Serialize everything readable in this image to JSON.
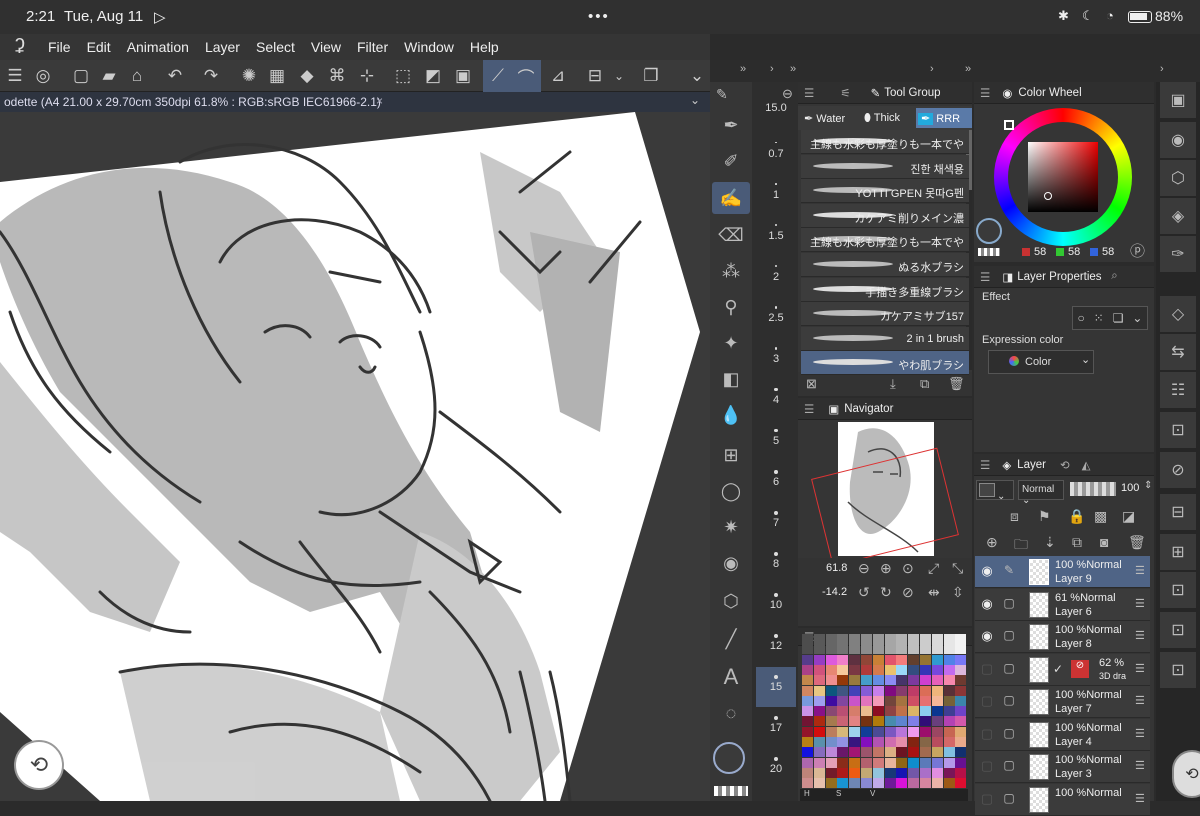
{
  "status": {
    "time": "2:21",
    "date": "Tue, Aug 11",
    "dots": "•••",
    "battery": "88%"
  },
  "menu": [
    "File",
    "Edit",
    "Animation",
    "Layer",
    "Select",
    "View",
    "Filter",
    "Window",
    "Help"
  ],
  "document": {
    "title": "odette (A4 21.00 x 29.70cm 350dpi 61.8% : RGB:sRGB IEC61966-2.1)",
    "close": "×"
  },
  "brush_sizes": [
    "15.0",
    "0.7",
    "1",
    "1.5",
    "2",
    "2.5",
    "3",
    "4",
    "5",
    "6",
    "7",
    "8",
    "10",
    "12",
    "15",
    "17",
    "20"
  ],
  "brush_size_selected": "15",
  "tool_group": {
    "title": "Tool Group",
    "tabs": [
      "Water",
      "Thick",
      "RRR"
    ],
    "active_tab": "RRR"
  },
  "brushes": [
    "主線も水彩も厚塗りも一本でや",
    "진한 채색용",
    "YOTTI GPEN 못따G펜",
    "カケアミ削りメイン濃",
    "主線も水彩も厚塗りも一本でや",
    "ぬる水ブラシ",
    "手描き多重線ブラシ",
    "カケアミサブ157",
    "2 in 1 brush",
    "やわ肌ブラシ"
  ],
  "color_wheel": {
    "title": "Color Wheel",
    "r": "58",
    "g": "58",
    "b": "58",
    "r_color": "#c83232",
    "g_color": "#32c832",
    "b_color": "#3264dc",
    "main_color": "#3a3a3a"
  },
  "layer_properties": {
    "title": "Layer Properties",
    "effect_label": "Effect",
    "expression_label": "Expression color",
    "color_value": "Color"
  },
  "navigator": {
    "title": "Navigator",
    "zoom": "61.8",
    "rotation": "-14.2"
  },
  "palette_labels": [
    "H",
    "S",
    "V"
  ],
  "layer_panel": {
    "title": "Layer",
    "blend": "Normal",
    "opacity": "100"
  },
  "layers": [
    {
      "pct": "100 %Normal",
      "name": "Layer 9",
      "selected": true,
      "visible": true
    },
    {
      "pct": "61 %Normal",
      "name": "Layer 6",
      "selected": false,
      "visible": true
    },
    {
      "pct": "100 %Normal",
      "name": "Layer 8",
      "selected": false,
      "visible": true
    },
    {
      "pct": "62 %",
      "name": "3D dra",
      "selected": false,
      "visible": false
    },
    {
      "pct": "100 %Normal",
      "name": "Layer 7",
      "selected": false,
      "visible": false
    },
    {
      "pct": "100 %Normal",
      "name": "Layer 4",
      "selected": false,
      "visible": false
    },
    {
      "pct": "100 %Normal",
      "name": "Layer 3",
      "selected": false,
      "visible": false
    },
    {
      "pct": "100 %Normal",
      "name": "",
      "selected": false,
      "visible": false
    }
  ]
}
